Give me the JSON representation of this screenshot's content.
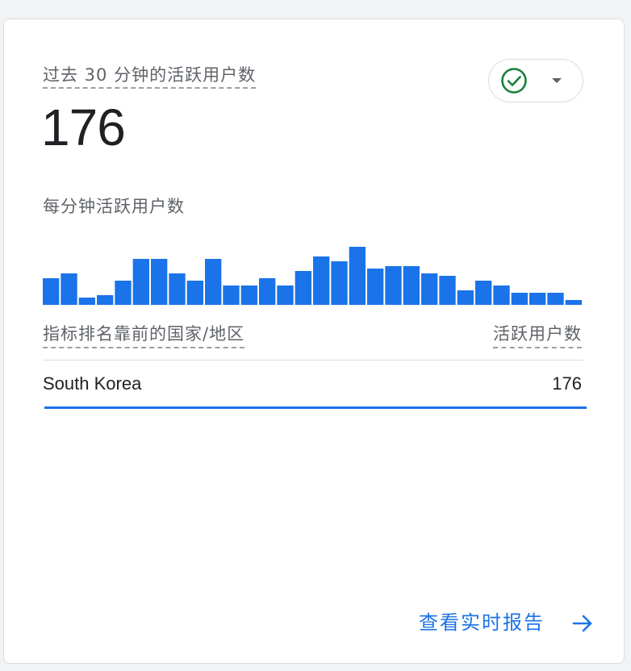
{
  "card": {
    "title": "过去 30 分钟的活跃用户数",
    "total": "176",
    "status_icon": "check-circle-icon",
    "dropdown_icon": "caret-down-icon",
    "status_color": "#188038"
  },
  "chart": {
    "subtitle": "每分钟活跃用户数",
    "bar_color": "#1a73e8"
  },
  "chart_data": {
    "type": "bar",
    "title": "每分钟活跃用户数",
    "xlabel": "",
    "ylabel": "",
    "values": [
      11,
      13,
      3,
      4,
      10,
      19,
      19,
      13,
      10,
      19,
      8,
      8,
      11,
      8,
      14,
      20,
      18,
      24,
      15,
      16,
      16,
      13,
      12,
      6,
      10,
      8,
      5,
      5,
      5,
      2
    ],
    "grid": false,
    "legend": "none"
  },
  "table": {
    "header_left": "指标排名靠前的国家/地区",
    "header_right": "活跃用户数",
    "rows": [
      {
        "name": "South Korea",
        "value": "176",
        "share": 1.0
      }
    ]
  },
  "footer": {
    "link_label": "查看实时报告",
    "link_icon": "arrow-right-icon",
    "link_color": "#1a73e8"
  }
}
